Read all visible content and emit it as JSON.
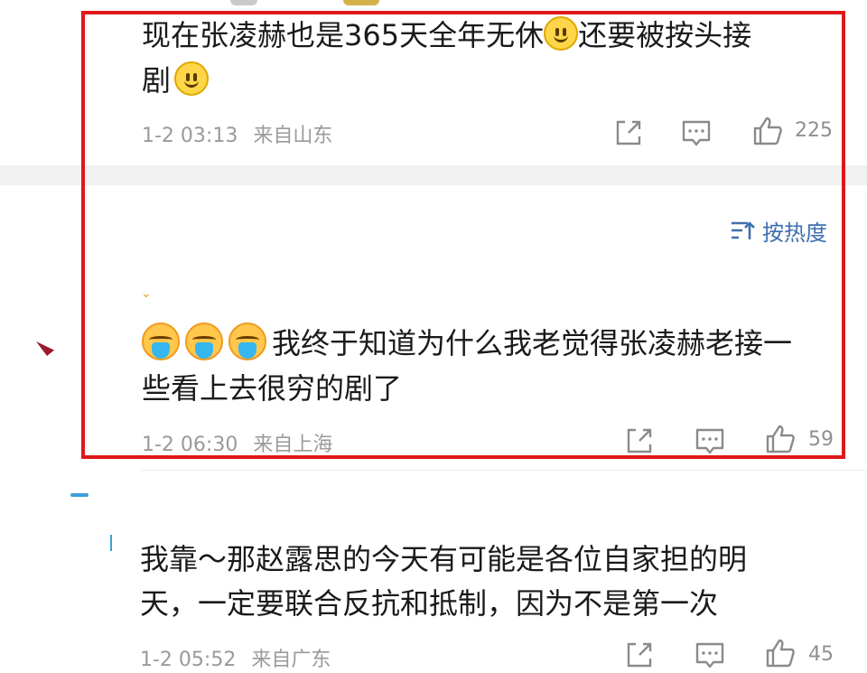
{
  "comments": [
    {
      "text_before_emoji": "现在张凌赫也是365天全年无休",
      "text_after_emoji": "还要被按头接",
      "text_line2": "剧",
      "emoji": "smile-emoji",
      "date": "1-2 03:13",
      "location": "来自山东",
      "likes": "225"
    },
    {
      "text_line1": "我终于知道为什么我老觉得张凌赫老接一",
      "text_line2": "些看上去很穷的剧了",
      "emoji": "crying-emoji",
      "date": "1-2 06:30",
      "location": "来自上海",
      "likes": "59"
    },
    {
      "text_line1": "我靠～那赵露思的今天有可能是各位自家担的明",
      "text_line2": "天，一定要联合反抗和抵制，因为不是第一次",
      "date": "1-2 05:52",
      "location": "来自广东",
      "likes": "45"
    }
  ],
  "sort": {
    "label": "按热度"
  },
  "icons": {
    "share": "share-icon",
    "comment": "comment-icon",
    "like": "like-icon",
    "sort": "sort-icon"
  },
  "colors": {
    "highlight_border": "#e01818",
    "meta_gray": "#9a9a9a",
    "sort_blue": "#3f6fb0"
  }
}
